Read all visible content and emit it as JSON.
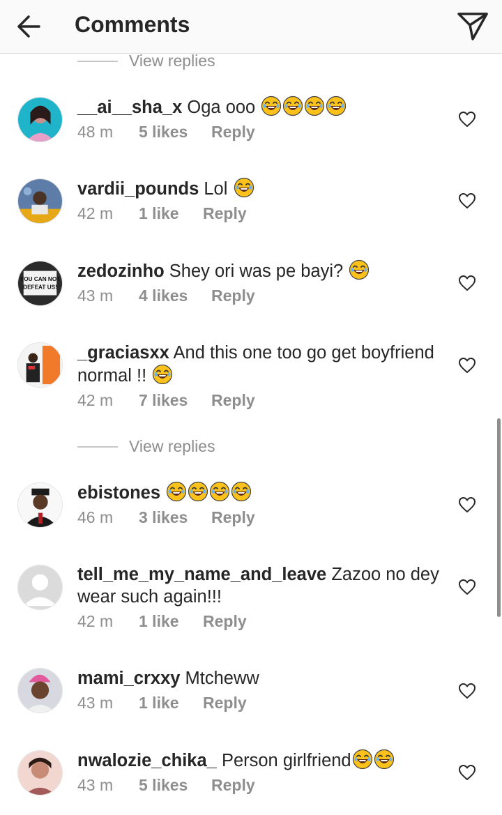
{
  "header": {
    "title": "Comments"
  },
  "view_replies_label": "View replies",
  "comments": [
    {
      "username": "__ai__sha_x",
      "text": "Oga ooo",
      "emoji_count": 4,
      "time": "48 m",
      "likes": "5 likes",
      "reply": "Reply"
    },
    {
      "username": "vardii_pounds",
      "text": "Lol",
      "emoji_count": 1,
      "time": "42 m",
      "likes": "1 like",
      "reply": "Reply"
    },
    {
      "username": "zedozinho",
      "text": "Shey ori was pe bayi?",
      "emoji_count": 1,
      "time": "43 m",
      "likes": "4 likes",
      "reply": "Reply",
      "avatar_text": "YOU CAN NOT DEFEAT US!"
    },
    {
      "username": "_graciasxx",
      "text": "And this one too go get boyfriend normal !!",
      "emoji_count": 1,
      "time": "42 m",
      "likes": "7 likes",
      "reply": "Reply"
    },
    {
      "username": "ebistones",
      "text": "",
      "emoji_count": 4,
      "time": "46 m",
      "likes": "3 likes",
      "reply": "Reply"
    },
    {
      "username": "tell_me_my_name_and_leave",
      "text": "Zazoo no dey wear such again!!!",
      "emoji_count": 0,
      "time": "42 m",
      "likes": "1 like",
      "reply": "Reply"
    },
    {
      "username": "mami_crxxy",
      "text": "Mtcheww",
      "emoji_count": 0,
      "time": "43 m",
      "likes": "1 like",
      "reply": "Reply"
    },
    {
      "username": "nwalozie_chika_",
      "text": "Person girlfriend",
      "emoji_count": 2,
      "time": "43 m",
      "likes": "5 likes",
      "reply": "Reply"
    }
  ],
  "colors": {
    "text": "#262626",
    "secondary": "#8e8e8e",
    "divider": "#dbdbdb",
    "emoji_face": "#fcc21b"
  },
  "icons": {
    "back": "arrow-left-icon",
    "send": "paper-plane-icon",
    "like": "heart-outline-icon",
    "emoji": "face-with-tears-of-joy-icon"
  }
}
